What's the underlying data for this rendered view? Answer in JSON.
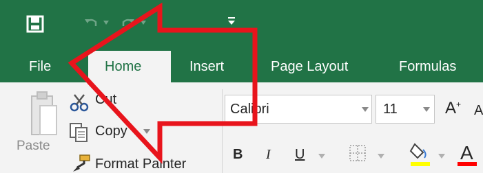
{
  "quick_access": {
    "save_icon": "save-icon",
    "undo_icon": "undo-icon",
    "redo_icon": "redo-icon",
    "customize_icon": "customize-quick-access-icon"
  },
  "tabs": [
    {
      "label": "File",
      "active": false
    },
    {
      "label": "Home",
      "active": true
    },
    {
      "label": "Insert",
      "active": false
    },
    {
      "label": "Page Layout",
      "active": false
    },
    {
      "label": "Formulas",
      "active": false
    }
  ],
  "clipboard": {
    "paste_label": "Paste",
    "cut_label": "Cut",
    "copy_label": "Copy",
    "format_painter_label": "Format Painter"
  },
  "font": {
    "font_name": "Calibri",
    "font_size": "11",
    "grow_font_label": "A",
    "shrink_font_label": "A",
    "bold_label": "B",
    "italic_label": "I",
    "underline_label": "U",
    "fill_color": "#ffff00",
    "font_color": "#ff0000"
  },
  "colors": {
    "excel_green": "#217346",
    "annotation_red": "#e8141c"
  }
}
